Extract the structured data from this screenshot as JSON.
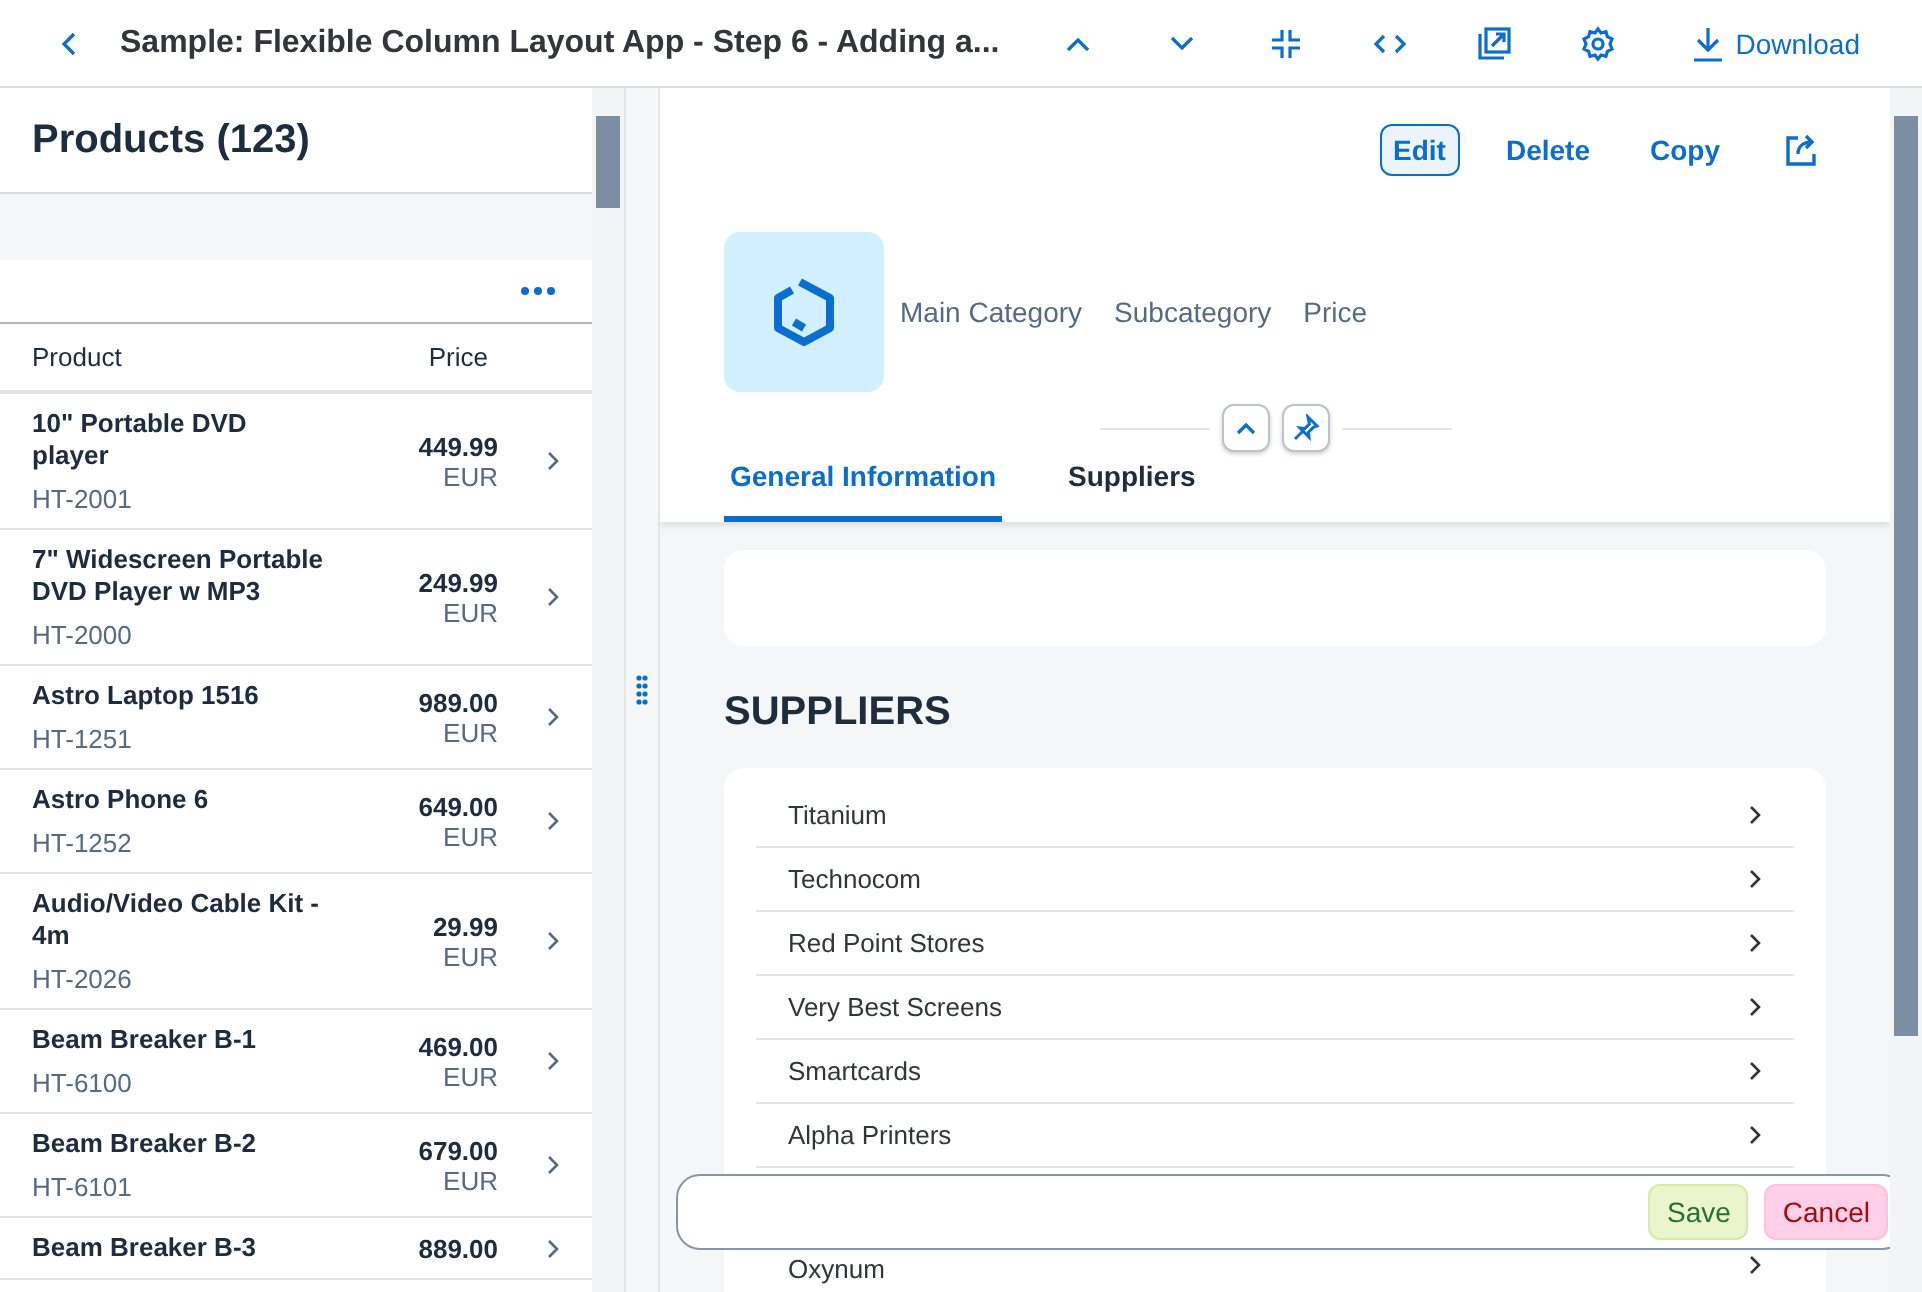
{
  "shell_bar": {
    "title": "Sample: Flexible Column Layout App - Step 6 - Adding a...",
    "download": "Download"
  },
  "master": {
    "title": "Products (123)",
    "columns": [
      "Product",
      "Price"
    ],
    "rows": [
      {
        "name": "10\" Portable DVD player",
        "id": "HT-2001",
        "price": "449.99",
        "currency": "EUR"
      },
      {
        "name": "7\" Widescreen Portable DVD Player w MP3",
        "id": "HT-2000",
        "price": "249.99",
        "currency": "EUR"
      },
      {
        "name": "Astro Laptop 1516",
        "id": "HT-1251",
        "price": "989.00",
        "currency": "EUR"
      },
      {
        "name": "Astro Phone 6",
        "id": "HT-1252",
        "price": "649.00",
        "currency": "EUR"
      },
      {
        "name": "Audio/Video Cable Kit - 4m",
        "id": "HT-2026",
        "price": "29.99",
        "currency": "EUR"
      },
      {
        "name": "Beam Breaker B-1",
        "id": "HT-6100",
        "price": "469.00",
        "currency": "EUR"
      },
      {
        "name": "Beam Breaker B-2",
        "id": "HT-6101",
        "price": "679.00",
        "currency": "EUR"
      },
      {
        "name": "Beam Breaker B-3",
        "price": "889.00"
      }
    ]
  },
  "detail": {
    "actions": [
      {
        "label": "Edit",
        "kind": "emphasized"
      },
      {
        "label": "Delete",
        "kind": "transparent"
      },
      {
        "label": "Copy",
        "kind": "transparent"
      }
    ],
    "attributes": [
      "Main Category",
      "Subcategory",
      "Price"
    ],
    "tabs": [
      {
        "label": "General Information",
        "selected": true
      },
      {
        "label": "Suppliers",
        "selected": false
      }
    ],
    "section_title": "SUPPLIERS",
    "suppliers": [
      "Titanium",
      "Technocom",
      "Red Point Stores",
      "Very Best Screens",
      "Smartcards",
      "Alpha Printers",
      "Oxynum"
    ]
  },
  "footer": {
    "buttons": [
      {
        "label": "Save",
        "kind": "accept"
      },
      {
        "label": "Cancel",
        "kind": "reject"
      }
    ]
  }
}
